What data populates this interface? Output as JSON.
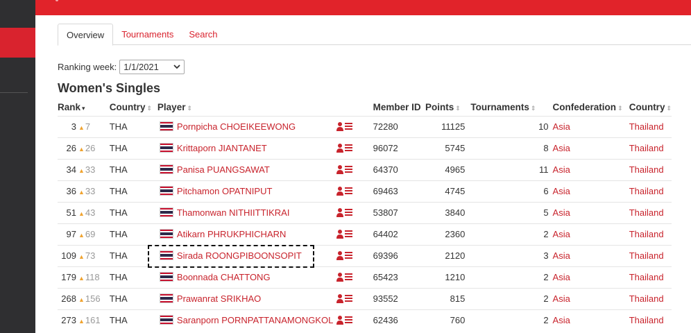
{
  "tabs": [
    {
      "label": "Overview"
    },
    {
      "label": "Tournaments"
    },
    {
      "label": "Search"
    }
  ],
  "ranking_week": {
    "label": "Ranking week:",
    "value": "1/1/2021"
  },
  "heading": "Women's Singles",
  "columns": {
    "rank": "Rank",
    "country": "Country",
    "player": "Player",
    "member_id": "Member ID",
    "points": "Points",
    "tournaments": "Tournaments",
    "confederation": "Confederation",
    "country2": "Country"
  },
  "rows": [
    {
      "rank": "3",
      "prev": "7",
      "country": "THA",
      "player": "Pornpicha CHOEIKEEWONG",
      "member_id": "72280",
      "points": "11125",
      "tournaments": "10",
      "confederation": "Asia",
      "country_name": "Thailand"
    },
    {
      "rank": "26",
      "prev": "26",
      "country": "THA",
      "player": "Krittaporn JIANTANET",
      "member_id": "96072",
      "points": "5745",
      "tournaments": "8",
      "confederation": "Asia",
      "country_name": "Thailand"
    },
    {
      "rank": "34",
      "prev": "33",
      "country": "THA",
      "player": "Panisa PUANGSAWAT",
      "member_id": "64370",
      "points": "4965",
      "tournaments": "11",
      "confederation": "Asia",
      "country_name": "Thailand"
    },
    {
      "rank": "36",
      "prev": "33",
      "country": "THA",
      "player": "Pitchamon OPATNIPUT",
      "member_id": "69463",
      "points": "4745",
      "tournaments": "6",
      "confederation": "Asia",
      "country_name": "Thailand"
    },
    {
      "rank": "51",
      "prev": "43",
      "country": "THA",
      "player": "Thamonwan NITHIITTIKRAI",
      "member_id": "53807",
      "points": "3840",
      "tournaments": "5",
      "confederation": "Asia",
      "country_name": "Thailand"
    },
    {
      "rank": "97",
      "prev": "69",
      "country": "THA",
      "player": "Atikarn PHRUKPHICHARN",
      "member_id": "64402",
      "points": "2360",
      "tournaments": "2",
      "confederation": "Asia",
      "country_name": "Thailand"
    },
    {
      "rank": "109",
      "prev": "73",
      "country": "THA",
      "player": "Sirada ROONGPIBOONSOPIT",
      "member_id": "69396",
      "points": "2120",
      "tournaments": "3",
      "confederation": "Asia",
      "country_name": "Thailand"
    },
    {
      "rank": "179",
      "prev": "118",
      "country": "THA",
      "player": "Boonnada CHATTONG",
      "member_id": "65423",
      "points": "1210",
      "tournaments": "2",
      "confederation": "Asia",
      "country_name": "Thailand"
    },
    {
      "rank": "268",
      "prev": "156",
      "country": "THA",
      "player": "Prawanrat SRIKHAO",
      "member_id": "93552",
      "points": "815",
      "tournaments": "2",
      "confederation": "Asia",
      "country_name": "Thailand"
    },
    {
      "rank": "273",
      "prev": "161",
      "country": "THA",
      "player": "Saranporn PORNPATTANAMONGKOL",
      "member_id": "62436",
      "points": "760",
      "tournaments": "2",
      "confederation": "Asia",
      "country_name": "Thailand"
    }
  ],
  "icons": {
    "flag": "thailand-flag-icon",
    "profile": "player-profile-icon",
    "sort": "sort-icon",
    "trend": "rank-up-arrow-icon"
  },
  "colors": {
    "accent": "#e1232a",
    "link": "#c8232c",
    "trend_up": "#f0a32f",
    "sidebar": "#2f2f31"
  }
}
